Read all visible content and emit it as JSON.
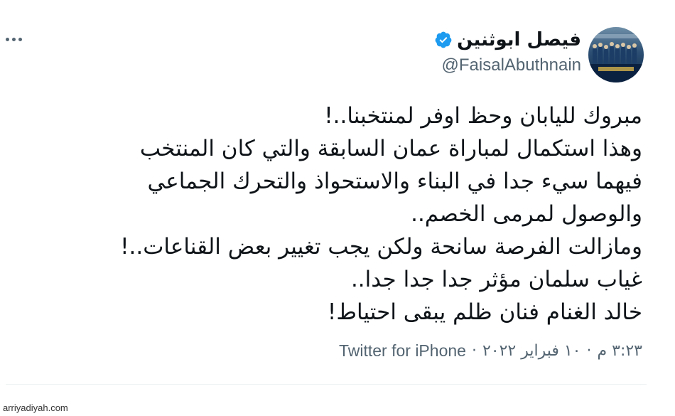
{
  "tweet": {
    "display_name": "فيصل ابوثنين",
    "handle": "@FaisalAbuthnain",
    "verified": true,
    "lines": [
      "مبروك لليابان وحظ اوفر لمنتخبنا..!",
      "وهذا استكمال لمباراة عمان السابقة والتي كان المنتخب",
      "فيهما سيء جدا في البناء والاستحواذ والتحرك الجماعي",
      "والوصول لمرمى الخصم..",
      "ومازالت الفرصة سانحة ولكن يجب تغيير بعض القناعات..!",
      "غياب سلمان مؤثر جدا جدا جدا..",
      "خالد الغنام فنان ظلم يبقى احتياط!"
    ],
    "time": "٣:٢٣ م",
    "date": "١٠ فبراير ٢٠٢٢",
    "separator": "·",
    "source": "Twitter for iPhone"
  },
  "watermark": "arriyadiyah.com",
  "icons": {
    "more": "more-horizontal-icon",
    "verified": "verified-badge-icon"
  },
  "colors": {
    "verified_blue": "#1d9bf0",
    "text_primary": "#0f1419",
    "text_secondary": "#536471"
  }
}
